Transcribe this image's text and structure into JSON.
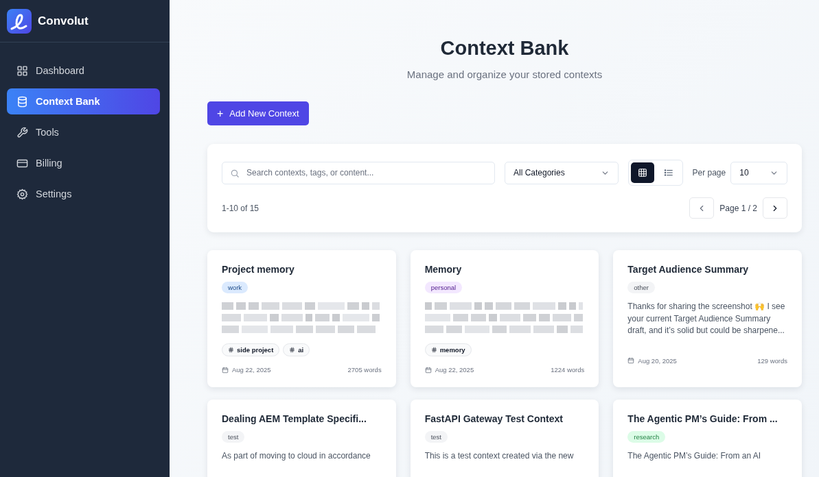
{
  "sidebar": {
    "brand": "Convolut",
    "items": [
      {
        "label": "Dashboard",
        "selected": false
      },
      {
        "label": "Context Bank",
        "selected": true
      },
      {
        "label": "Tools",
        "selected": false
      },
      {
        "label": "Billing",
        "selected": false
      },
      {
        "label": "Settings",
        "selected": false
      }
    ]
  },
  "header": {
    "title": "Context Bank",
    "subtitle": "Manage and organize your stored contexts"
  },
  "add_button": {
    "icon": "+",
    "label": "Add New Context"
  },
  "toolbar": {
    "search": {
      "placeholder": "Search contexts, tags, or content..."
    },
    "category": {
      "value": "All Categories"
    },
    "views": [
      {
        "selected": true
      },
      {
        "selected": false
      }
    ],
    "per_page": {
      "label": "Per page",
      "value": "10"
    },
    "count": "1-10 of 15",
    "page": "Page 1 / 2"
  },
  "cards": [
    {
      "title": "Project memory",
      "category": {
        "label": "work",
        "color": "#dbeafe"
      },
      "blurred": true,
      "tags": [
        "side project",
        "ai"
      ],
      "date": "Aug 22, 2025",
      "words": "2705 words"
    },
    {
      "title": "Memory",
      "category": {
        "label": "personal",
        "color": "#f3e8ff"
      },
      "blurred": true,
      "tags": [
        "memory"
      ],
      "date": "Aug 22, 2025",
      "words": "1224 words"
    },
    {
      "title": "Target Audience Summary",
      "category": {
        "label": "other",
        "color": "#f3f4f6"
      },
      "blurred": false,
      "excerpt": "Thanks for sharing the screenshot 🙌 I see your current Target Audience Summary draft, and it’s solid but could be sharpene...",
      "date": "Aug 20, 2025",
      "words": "129 words"
    },
    {
      "title": "Dealing AEM Template Specifi...",
      "category": {
        "label": "test",
        "color": "#f3f4f6"
      },
      "blurred": false,
      "excerpt": "As part of moving to cloud in accordance"
    },
    {
      "title": "FastAPI Gateway Test Context",
      "category": {
        "label": "test",
        "color": "#f3f4f6"
      },
      "blurred": false,
      "excerpt": "This is a test context created via the new"
    },
    {
      "title": "The Agentic PM’s Guide: From ...",
      "category": {
        "label": "research",
        "color": "#dcfce7"
      },
      "blurred": false,
      "excerpt": "The Agentic PM’s Guide: From an AI"
    }
  ]
}
